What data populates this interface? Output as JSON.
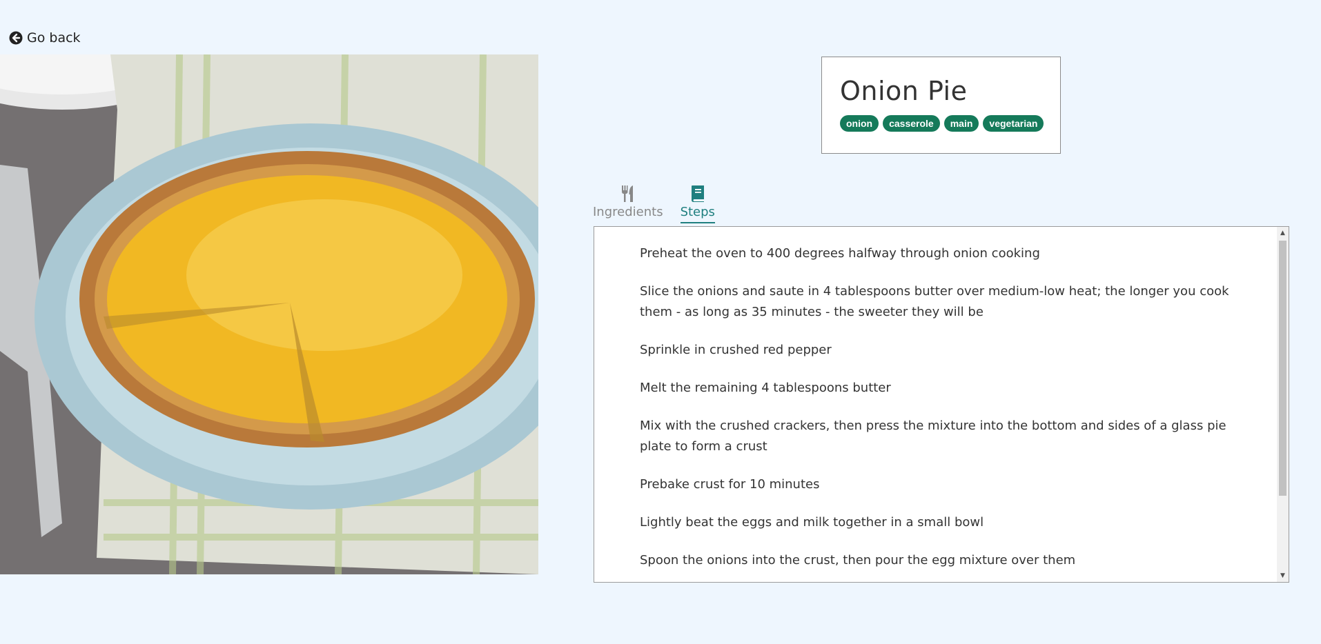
{
  "nav": {
    "back_label": "Go back",
    "back_icon": "arrow-circle-left-icon"
  },
  "recipe": {
    "title": "Onion Pie",
    "tags": [
      "onion",
      "casserole",
      "main",
      "vegetarian"
    ],
    "image_icon": "onion-pie-photo"
  },
  "tabs": [
    {
      "label": "Ingredients",
      "icon": "utensils-icon",
      "active": false
    },
    {
      "label": "Steps",
      "icon": "book-icon",
      "active": true
    }
  ],
  "steps": [
    "Preheat the oven to 400 degrees halfway through onion cooking",
    "Slice the onions and saute in 4 tablespoons butter over medium-low heat; the longer you cook them - as long as 35 minutes - the sweeter they will be",
    "Sprinkle in crushed red pepper",
    "Melt the remaining 4 tablespoons butter",
    "Mix with the crushed crackers, then press the mixture into the bottom and sides of a glass pie plate to form a crust",
    "Prebake crust for 10 minutes",
    "Lightly beat the eggs and milk together in a small bowl",
    "Spoon the onions into the crust, then pour the egg mixture over them"
  ],
  "colors": {
    "background": "#eef6fe",
    "tag": "#157a5a",
    "active_tab": "#1f7f7f"
  }
}
